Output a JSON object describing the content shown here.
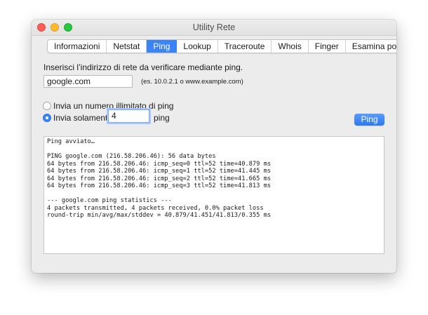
{
  "window": {
    "title": "Utility Rete"
  },
  "tabs": [
    {
      "label": "Informazioni",
      "active": false
    },
    {
      "label": "Netstat",
      "active": false
    },
    {
      "label": "Ping",
      "active": true
    },
    {
      "label": "Lookup",
      "active": false
    },
    {
      "label": "Traceroute",
      "active": false
    },
    {
      "label": "Whois",
      "active": false
    },
    {
      "label": "Finger",
      "active": false
    },
    {
      "label": "Esamina porte",
      "active": false
    }
  ],
  "ping": {
    "prompt": "Inserisci l’indirizzo di rete da verificare mediante ping.",
    "host_value": "google.com",
    "example": "(es. 10.0.2.1 o www.example.com)",
    "unlimited_label": "Invia un numero illimitato di ping",
    "only_label": "Invia solamente",
    "count_value": "4",
    "suffix": "ping",
    "button_label": "Ping",
    "selected_option": "only"
  },
  "output": {
    "lines": [
      "Ping avviato…",
      "",
      "PING google.com (216.58.206.46): 56 data bytes",
      "64 bytes from 216.58.206.46: icmp_seq=0 ttl=52 time=40.879 ms",
      "64 bytes from 216.58.206.46: icmp_seq=1 ttl=52 time=41.445 ms",
      "64 bytes from 216.58.206.46: icmp_seq=2 ttl=52 time=41.665 ms",
      "64 bytes from 216.58.206.46: icmp_seq=3 ttl=52 time=41.813 ms",
      "",
      "--- google.com ping statistics ---",
      "4 packets transmitted, 4 packets received, 0.0% packet loss",
      "round-trip min/avg/max/stddev = 40.879/41.451/41.813/0.355 ms"
    ]
  },
  "colors": {
    "accent": "#3b84f5",
    "window_bg": "#ececec",
    "close": "#fe5f57",
    "minimize": "#febc2e",
    "maximize": "#28c840"
  }
}
